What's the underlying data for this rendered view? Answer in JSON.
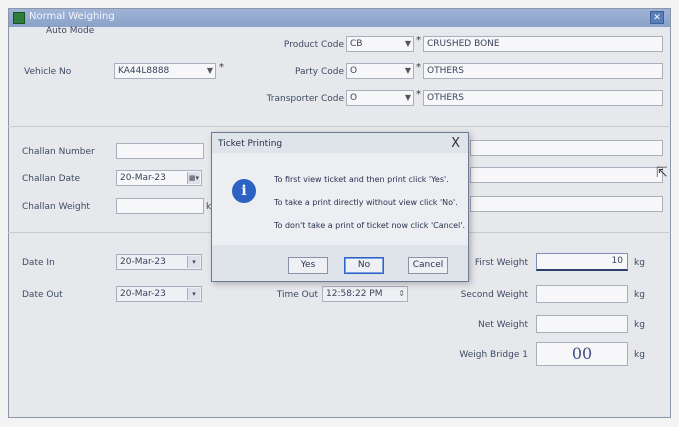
{
  "window": {
    "title": "Normal Weighing"
  },
  "header": {
    "mode": "Auto Mode"
  },
  "vehicle": {
    "label": "Vehicle No",
    "value": "KA44L8888"
  },
  "product": {
    "label": "Product Code",
    "code": "CB",
    "name": "CRUSHED BONE"
  },
  "party": {
    "label": "Party Code",
    "code": "O",
    "name": "OTHERS"
  },
  "transporter": {
    "label": "Transporter Code",
    "code": "O",
    "name": "OTHERS"
  },
  "required_mark": "*",
  "challan": {
    "number_label": "Challan Number",
    "date_label": "Challan Date",
    "date_value": "20-Mar-23",
    "weight_label": "Challan Weight",
    "weight_unit": "kg"
  },
  "date_in": {
    "label": "Date In",
    "value": "20-Mar-23"
  },
  "date_out": {
    "label": "Date Out",
    "value": "20-Mar-23"
  },
  "time_out": {
    "label": "Time Out",
    "value": "12:58:22 PM"
  },
  "weights": {
    "first_label": "First Weight",
    "first_value": "10",
    "second_label": "Second Weight",
    "net_label": "Net Weight",
    "unit": "kg",
    "bridge_label": "Weigh Bridge 1",
    "bridge_value": "00"
  },
  "dialog": {
    "title": "Ticket Printing",
    "close": "X",
    "line1": "To first view ticket and then print click 'Yes'.",
    "line2": "To take a print directly without view click 'No'.",
    "line3": "To don't take a print of ticket now click 'Cancel'.",
    "yes": "Yes",
    "no": "No",
    "cancel": "Cancel",
    "icon": "info-icon"
  },
  "colors": {
    "accent": "#2b62c4",
    "titlebar": "#8aa2c9"
  }
}
